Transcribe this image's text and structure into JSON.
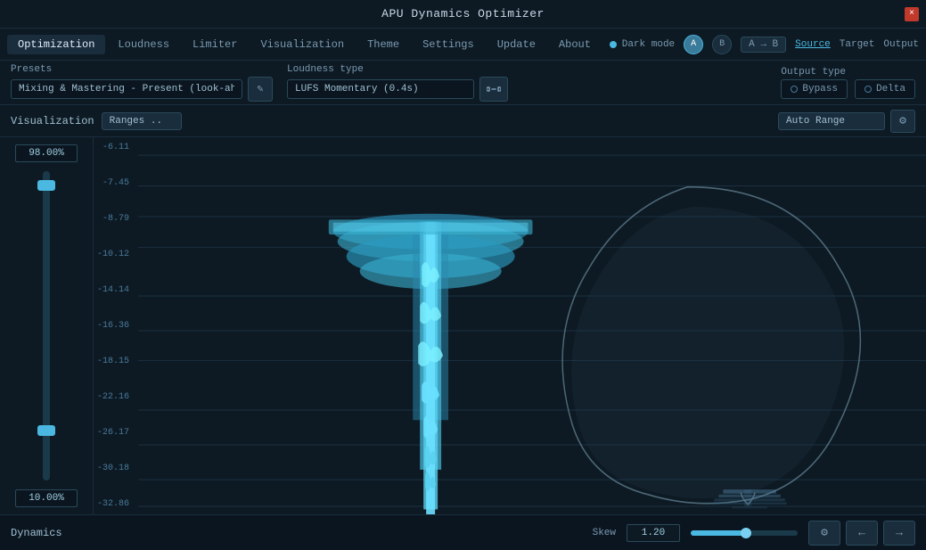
{
  "titleBar": {
    "title": "APU Dynamics Optimizer",
    "closeIcon": "×"
  },
  "nav": {
    "tabs": [
      {
        "label": "Optimization",
        "active": true
      },
      {
        "label": "Loudness",
        "active": false
      },
      {
        "label": "Limiter",
        "active": false
      },
      {
        "label": "Visualization",
        "active": false
      },
      {
        "label": "Theme",
        "active": false
      },
      {
        "label": "Settings",
        "active": false
      },
      {
        "label": "Update",
        "active": false
      },
      {
        "label": "About",
        "active": false
      }
    ],
    "darkMode": "Dark mode",
    "abButtons": [
      "A",
      "B",
      "A → B"
    ],
    "links": [
      "Source",
      "Target",
      "Output"
    ]
  },
  "controls": {
    "presetsLabel": "Presets",
    "presetsValue": "Mixing & Mastering - Present (look-ahead)",
    "editIcon": "✎",
    "loudnessLabel": "Loudness type",
    "loudnessValue": "LUFS Momentary (0.4s)",
    "outputLabel": "Output type",
    "outputOptions": [
      "Bypass",
      "Delta"
    ]
  },
  "visualization": {
    "label": "Visualization",
    "rangeLabel": "Ranges ..",
    "autoRangeLabel": "Auto Range",
    "gearIcon": "⚙"
  },
  "sliderPanel": {
    "topPercent": "98.00%",
    "bottomPercent": "10.00%"
  },
  "yAxis": {
    "labels": [
      "-6.11",
      "-7.45",
      "-8.79",
      "-10.12",
      "-14.14",
      "-16.36",
      "-18.15",
      "-22.16",
      "-26.17",
      "-30.18",
      "-32.86"
    ]
  },
  "bottomBar": {
    "dynamicsLabel": "Dynamics",
    "skewLabel": "Skew",
    "skewValue": "1.20",
    "gearIcon": "⚙",
    "prevIcon": "←",
    "nextIcon": "→"
  }
}
